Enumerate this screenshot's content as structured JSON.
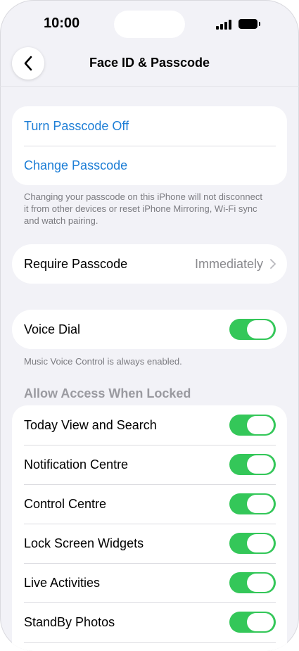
{
  "status_bar": {
    "time": "10:00"
  },
  "header": {
    "title": "Face ID & Passcode"
  },
  "passcode_group": {
    "turn_off": "Turn Passcode Off",
    "change": "Change Passcode",
    "footnote": "Changing your passcode on this iPhone will not disconnect it from other devices or reset iPhone Mirroring, Wi-Fi sync and watch pairing."
  },
  "require_passcode": {
    "label": "Require Passcode",
    "value": "Immediately"
  },
  "voice_dial": {
    "label": "Voice Dial",
    "enabled": true,
    "footnote": "Music Voice Control is always enabled."
  },
  "allow_access": {
    "header": "Allow Access When Locked",
    "items": [
      {
        "label": "Today View and Search",
        "enabled": true
      },
      {
        "label": "Notification Centre",
        "enabled": true
      },
      {
        "label": "Control Centre",
        "enabled": true
      },
      {
        "label": "Lock Screen Widgets",
        "enabled": true
      },
      {
        "label": "Live Activities",
        "enabled": true
      },
      {
        "label": "StandBy Photos",
        "enabled": true
      }
    ]
  },
  "colors": {
    "accent": "#1d7ed6",
    "toggle_on": "#34c759",
    "background": "#f2f2f7"
  }
}
